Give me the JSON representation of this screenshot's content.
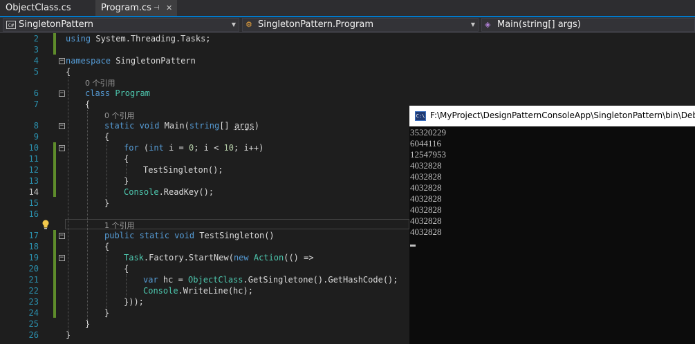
{
  "tabs": [
    {
      "label": "ObjectClass.cs"
    },
    {
      "label": "Program.cs",
      "pin": "⊣",
      "close": "✕"
    }
  ],
  "nav": {
    "project": "SingletonPattern",
    "type": "SingletonPattern.Program",
    "member": "Main(string[] args)",
    "cs_icon": "C#"
  },
  "editor": {
    "line_numbers": [
      "2",
      "3",
      "4",
      "5",
      "6",
      "7",
      "8",
      "9",
      "10",
      "11",
      "12",
      "13",
      "14",
      "15",
      "16",
      "17",
      "18",
      "19",
      "20",
      "21",
      "22",
      "23",
      "24",
      "25",
      "26"
    ],
    "current_line": "14",
    "lens": {
      "program_refs": "0 个引用",
      "main_refs": "0 个引用",
      "test_refs": "1 个引用"
    },
    "code": {
      "l2_kw": "using",
      "l2_rest": " System.Threading.Tasks;",
      "l4_kw": "namespace",
      "l4_rest": " SingletonPattern",
      "l5": "{",
      "l6_kw": "class",
      "l6_ty": "Program",
      "l7": "{",
      "l8_kw": "static void",
      "l8_name": " Main(",
      "l8_kw2": "string",
      "l8_mid": "[] ",
      "l8_args": "args",
      "l8_end": ")",
      "l9": "{",
      "l10_kw": "for",
      "l10_a": " (",
      "l10_kw2": "int",
      "l10_b": " i = ",
      "l10_n1": "0",
      "l10_c": "; i < ",
      "l10_n2": "10",
      "l10_d": "; i++)",
      "l11": "{",
      "l12": "TestSingleton();",
      "l13": "}",
      "l14_ty": "Console",
      "l14_rest": ".ReadKey();",
      "l15": "}",
      "l17_kw": "public static void",
      "l17_rest": " TestSingleton()",
      "l18": "{",
      "l19_ty": "Task",
      "l19_a": ".Factory.StartNew(",
      "l19_kw": "new",
      "l19_sp": " ",
      "l19_ty2": "Action",
      "l19_b": "(() =>",
      "l20": "{",
      "l21_kw": "var",
      "l21_a": " hc = ",
      "l21_ty": "ObjectClass",
      "l21_b": ".GetSingletone().GetHashCode();",
      "l22_ty": "Console",
      "l22_rest": ".WriteLine(hc);",
      "l23": "}));",
      "l24": "}",
      "l25": "}",
      "l26": "}"
    }
  },
  "console": {
    "icon": "C:\\",
    "title": "F:\\MyProject\\DesignPatternConsoleApp\\SingletonPattern\\bin\\Debu",
    "output": [
      "35320229",
      "6044116",
      "12547953",
      "4032828",
      "4032828",
      "4032828",
      "4032828",
      "4032828",
      "4032828",
      "4032828"
    ]
  },
  "colors": {
    "keyword": "#569cd6",
    "type": "#4ec9b0",
    "number": "#b5cea8",
    "line_number": "#2b91af",
    "change_bar": "#5e8c2b",
    "accent": "#007acc"
  }
}
